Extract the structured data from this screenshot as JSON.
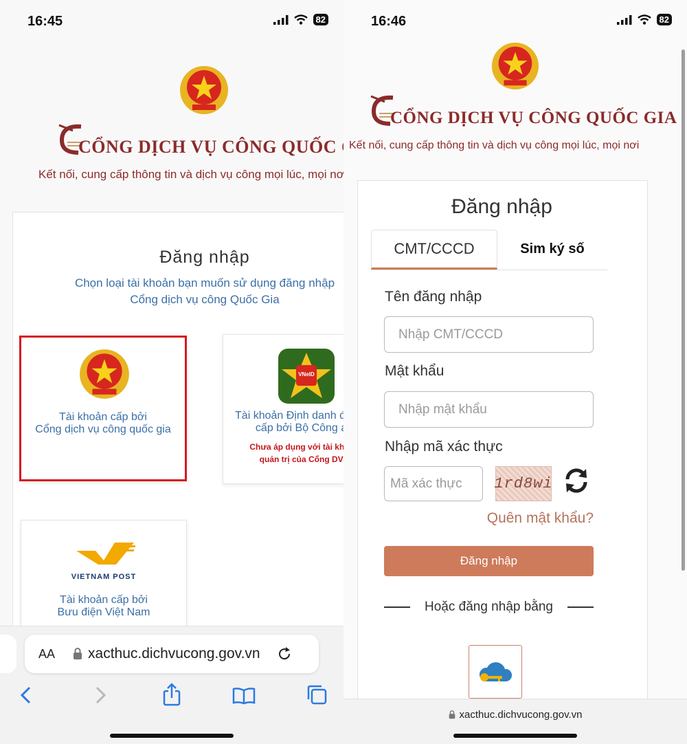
{
  "left": {
    "status": {
      "time": "16:45",
      "battery": "82"
    },
    "header": {
      "brand": "CỔNG DỊCH VỤ CÔNG QUỐC GIA",
      "tagline": "Kết nối, cung cấp thông tin và dịch vụ công mọi lúc, mọi nơi"
    },
    "login": {
      "title": "Đăng nhập",
      "subtitle_line1": "Chọn loại tài khoản bạn muốn sử dụng đăng nhập",
      "subtitle_line2": "Cổng dịch vụ công Quốc Gia"
    },
    "accounts": [
      {
        "line1": "Tài khoản cấp bởi",
        "line2": "Cổng dịch vụ công quốc gia"
      },
      {
        "line1": "Tài khoản Định danh điện tử",
        "line2": "cấp bởi Bộ Công an",
        "warn1": "Chưa áp dụng với tài khoản",
        "warn2": "quản trị của Cổng DVC",
        "logo_text": "VNeID"
      },
      {
        "line1": "Tài khoản cấp bởi",
        "line2": "Bưu điện Việt Nam",
        "logo_text": "VIETNAM POST"
      }
    ],
    "browser": {
      "aa": "AA",
      "url": "xacthuc.dichvucong.gov.vn"
    }
  },
  "right": {
    "status": {
      "time": "16:46",
      "battery": "82"
    },
    "header": {
      "brand": "CỔNG DỊCH VỤ CÔNG QUỐC GIA",
      "tagline": "Kết nối, cung cấp thông tin và dịch vụ công mọi lúc, mọi nơi"
    },
    "login": {
      "title": "Đăng nhập",
      "tabs": [
        "CMT/CCCD",
        "Sim ký số"
      ],
      "username_label": "Tên đăng nhập",
      "username_placeholder": "Nhập CMT/CCCD",
      "password_label": "Mật khẩu",
      "password_placeholder": "Nhập mật khẩu",
      "captcha_label": "Nhập mã xác thực",
      "captcha_placeholder": "Mã xác thực",
      "captcha_text": "1rd8wi",
      "forgot": "Quên mật khẩu?",
      "submit": "Đăng nhập",
      "or_text": "Hoặc đăng nhập bằng"
    },
    "browser": {
      "url": "xacthuc.dichvucong.gov.vn"
    }
  },
  "colors": {
    "brand": "#8b2b2b",
    "accent": "#cd7b5b",
    "link": "#3b6fa6",
    "highlight": "#d71920"
  }
}
